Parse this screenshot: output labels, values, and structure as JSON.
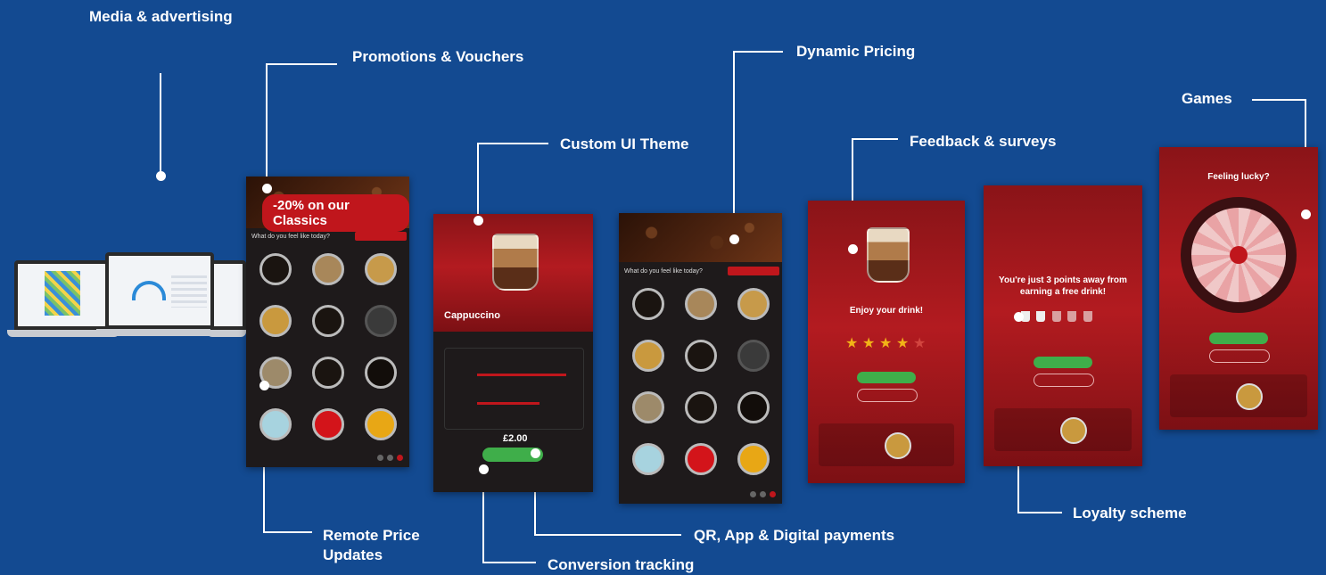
{
  "labels": {
    "media": "Media & advertising",
    "promotions": "Promotions & Vouchers",
    "dynamic_pricing": "Dynamic Pricing",
    "custom_ui": "Custom UI Theme",
    "feedback": "Feedback & surveys",
    "games": "Games",
    "remote_price": "Remote Price Updates",
    "qr_app": "QR, App & Digital payments",
    "conversion": "Conversion tracking",
    "loyalty": "Loyalty scheme"
  },
  "screens": {
    "promo_banner": "-20% on our Classics",
    "menu_question": "What do you feel like today?",
    "custom_drink": "Cappuccino",
    "custom_price": "£2.00",
    "feedback_title": "Enjoy your drink!",
    "feedback_rating": 4,
    "loyalty_message": "You're just 3 points away from earning a free drink!",
    "game_title": "Feeling lucky?"
  },
  "colors": {
    "background": "#134a91",
    "accent_red": "#c0161c",
    "accent_green": "#3fae4a"
  }
}
